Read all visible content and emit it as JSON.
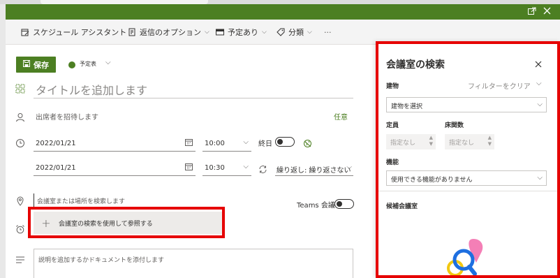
{
  "app": {
    "accent": "#4c7f22",
    "highlight": "#e60000"
  },
  "window": {
    "titlebar_icons": [
      "popout-icon",
      "close-icon"
    ]
  },
  "toolbar": {
    "schedule_assistant": "スケジュール アシスタント",
    "reply_options": "返信のオプション",
    "busy": "予定あり",
    "category": "分類",
    "more": "···"
  },
  "header": {
    "save_label": "保存",
    "calendar": "予定表"
  },
  "form": {
    "title_placeholder": "タイトルを追加します",
    "attendees_placeholder": "出席者を招待します",
    "optional": "任意",
    "start_date": "2022/01/21",
    "start_time": "10:00",
    "all_day": "終日",
    "end_date": "2022/01/21",
    "end_time": "10:30",
    "repeat": "繰り返し: 繰り返さない",
    "location_placeholder": "会議室または場所を検索します",
    "teams_meeting": "Teams 会議",
    "room_finder_button": "会議室の検索を使用して参照する",
    "description_placeholder": "説明を追加するかドキュメントを添付します"
  },
  "room_finder": {
    "title": "会議室の検索",
    "building_label": "建物",
    "clear_filter": "フィルターをクリア",
    "building_placeholder": "建物を選択",
    "capacity_label": "定員",
    "floor_label": "床関数",
    "capacity_value": "指定なし",
    "floor_value": "指定なし",
    "features_label": "機能",
    "features_value": "使用できる機能がありません",
    "suggested_label": "候補会議室"
  }
}
